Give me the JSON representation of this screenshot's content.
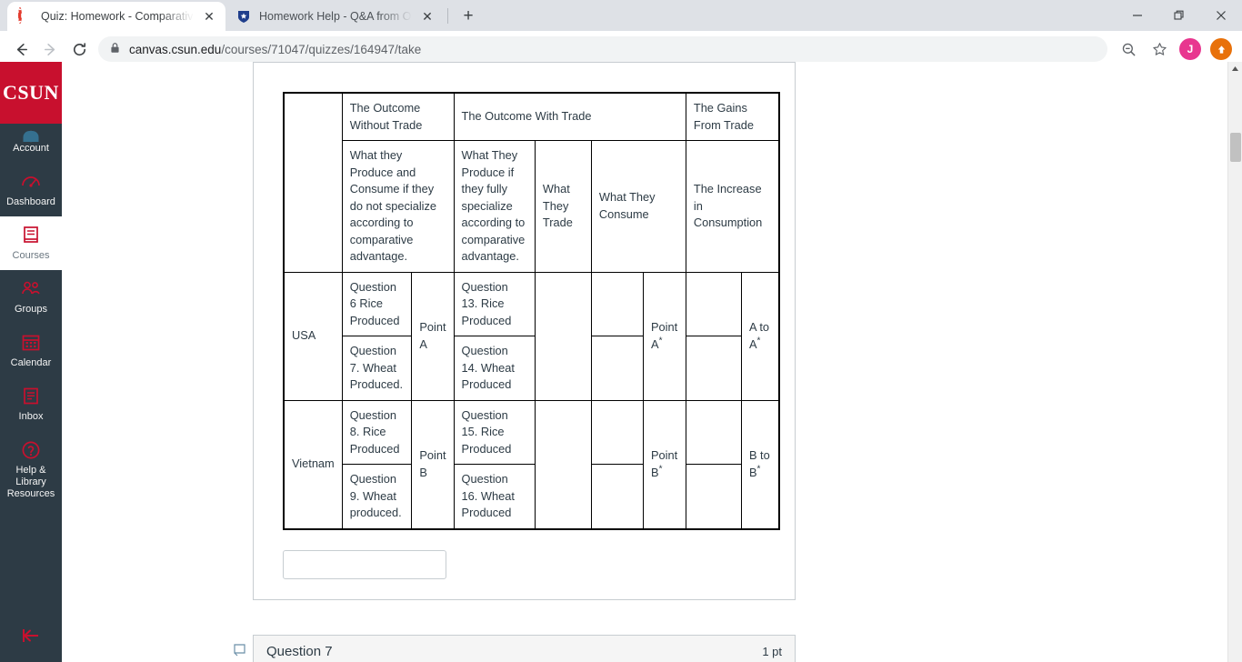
{
  "browser": {
    "tabs": [
      {
        "title": "Quiz: Homework - Comparative A",
        "favicon": "canvas-icon",
        "active": true,
        "close_label": "✕"
      },
      {
        "title": "Homework Help - Q&A from Onl",
        "favicon": "chegg-shield-icon",
        "active": false,
        "close_label": "✕"
      }
    ],
    "new_tab_label": "+",
    "window_controls": {
      "minimize": "—",
      "maximize": "❐",
      "close": "✕"
    },
    "nav": {
      "back": "←",
      "forward": "→",
      "reload": "⟳"
    },
    "address": {
      "lock": "lock-icon",
      "url_host": "canvas.csun.edu",
      "url_path": "/courses/71047/quizzes/164947/take",
      "full_url": "canvas.csun.edu/courses/71047/quizzes/164947/take"
    },
    "toolbar_right": {
      "zoom_out": "zoom-out-icon",
      "bookmark": "star-icon",
      "profile_initial": "J",
      "update": "update-icon"
    }
  },
  "sidebar": {
    "logo": "CSUN",
    "items": [
      {
        "label": "Account",
        "icon": "user-avatar-icon",
        "active": false
      },
      {
        "label": "Dashboard",
        "icon": "dashboard-gauge-icon",
        "active": false
      },
      {
        "label": "Courses",
        "icon": "courses-book-icon",
        "active": true
      },
      {
        "label": "Groups",
        "icon": "groups-people-icon",
        "active": false
      },
      {
        "label": "Calendar",
        "icon": "calendar-icon",
        "active": false
      },
      {
        "label": "Inbox",
        "icon": "inbox-tray-icon",
        "active": false
      },
      {
        "label": "Help & Library Resources",
        "icon": "help-question-icon",
        "active": false
      }
    ],
    "collapse_label": "collapse-nav-icon"
  },
  "quiz": {
    "table": {
      "header_row1": {
        "corner": "",
        "without_trade": "The Outcome Without Trade",
        "with_trade": "The Outcome With Trade",
        "gains": "The Gains From Trade"
      },
      "header_row2": {
        "corner": "",
        "produce_consume": "What they Produce and Consume if they do not specialize according to comparative advantage.",
        "produce_specialize": "What They Produce if they fully specialize according to comparative advantage.",
        "what_they_trade": "What They Trade",
        "what_they_consume": "What They Consume",
        "increase": "The Increase in Consumption"
      },
      "rows": [
        {
          "country": "USA",
          "no_trade_rice": "Question 6 Rice Produced",
          "no_trade_wheat": "Question 7. Wheat Produced.",
          "point_no_trade": "Point A",
          "trade_rice": "Question 13. Rice Produced",
          "trade_wheat": "Question 14. Wheat Produced",
          "what_trade_top": "",
          "what_trade_bottom": "",
          "consume_top": "",
          "consume_bottom": "",
          "point_consume": "Point A",
          "point_consume_sup": "*",
          "increase_top": "",
          "increase_bottom": "",
          "gain": "A to A",
          "gain_sup": "*"
        },
        {
          "country": "Vietnam",
          "no_trade_rice": "Question 8. Rice Produced",
          "no_trade_wheat": "Question 9. Wheat produced.",
          "point_no_trade": "Point B",
          "trade_rice": "Question 15. Rice Produced",
          "trade_wheat": "Question 16. Wheat Produced",
          "what_trade_top": "",
          "what_trade_bottom": "",
          "consume_top": "",
          "consume_bottom": "",
          "point_consume": "Point B",
          "point_consume_sup": "*",
          "increase_top": "",
          "increase_bottom": "",
          "gain": "B to B",
          "gain_sup": "*"
        }
      ]
    },
    "answer_input": {
      "value": "",
      "placeholder": ""
    },
    "next_question": {
      "title": "Question 7",
      "points": "1 pt"
    }
  },
  "colors": {
    "csun_red": "#c8102e",
    "canvas_dark": "#2d3b45",
    "question_red": "#ff2f2f",
    "profile_pink": "#e8368f",
    "update_orange": "#e8710a"
  }
}
